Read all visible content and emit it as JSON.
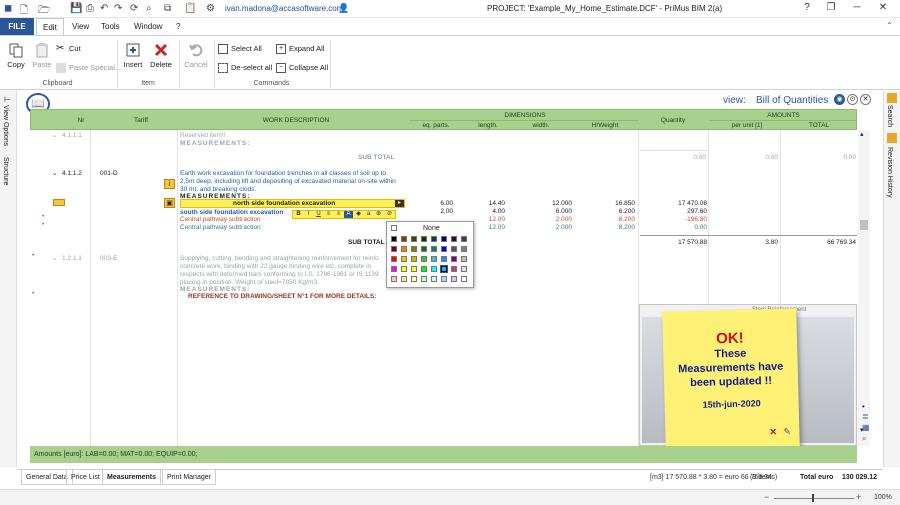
{
  "title_bar": {
    "user": "ivan.madona@accasoftware.com",
    "project": "PROJECT: 'Example_My_Home_Estimate.DCF' - PriMus   BIM 2(a)"
  },
  "menu": {
    "tabs": [
      "FILE",
      "Edit",
      "View",
      "Tools",
      "Window",
      "?"
    ]
  },
  "ribbon": {
    "copy": "Copy",
    "paste": "Paste",
    "cut": "Cut",
    "paste_special": "Paste Special...",
    "clipboard_group": "Clipboard",
    "insert": "Insert",
    "delete": "Delete",
    "item_group": "Item",
    "cancel": "Cancel",
    "select_all": "Select All",
    "deselect_all": "De-select all",
    "expand_all": "Expand All",
    "collapse_all": "Collapse All",
    "commands_group": "Commands"
  },
  "side_panels": {
    "left": [
      "View Options",
      "Structure"
    ],
    "right": [
      "Search",
      "Revision History"
    ]
  },
  "view": {
    "label": "view:",
    "name": "Bill of Quantities"
  },
  "table": {
    "headers": {
      "nr": "Nr",
      "tariff": "Tariff",
      "description": "WORK DESCRIPTION",
      "dimensions": "DIMENSIONS",
      "eq_parts": "eq. parts.",
      "length": "length.",
      "width": "width.",
      "height": "H/Weight",
      "quantity": "Quantity",
      "amounts": "AMOUNTS",
      "per_unit": "per unit [1]",
      "total": "TOTAL"
    },
    "row1": {
      "nr": "4.1.1.1",
      "desc": "Reserved item!!",
      "measurements": "MEASUREMENTS:",
      "subtotal_label": "SUB TOTAL",
      "quantity": "0.00",
      "per_unit": "0.00",
      "total": "0.00"
    },
    "row2": {
      "nr": "4.1.1.2",
      "tariff": "001-D",
      "desc": [
        "Earth work excavation for foundation trenches in all classes of soil up to",
        "2,5m deep, including lift and depositing of excavated material on-site within",
        "30 mt. and breaking clods."
      ],
      "measurements": "MEASUREMENTS:",
      "lines": [
        {
          "desc": "north side foundation excavation",
          "eq": "6.00",
          "len": "14.40",
          "wid": "12.000",
          "h": "16.850",
          "qty": "17 470.08",
          "style": "edit"
        },
        {
          "desc": "south side foundation excavation",
          "eq": "2.00",
          "len": "4.00",
          "wid": "6.000",
          "h": "6.200",
          "qty": "297.60",
          "style": "blue"
        },
        {
          "desc": "Central pathway subtraction",
          "eq": "",
          "len": "12.00",
          "wid": "2.000",
          "h": "8.200",
          "qty": "-196.80",
          "style": "red"
        },
        {
          "desc": "Central pathway subtraction",
          "eq": "",
          "len": "12.00",
          "wid": "2.000",
          "h": "8.200",
          "qty": "0.00",
          "style": "teal"
        }
      ],
      "subtotal_label": "SUB TOTAL",
      "quantity": "17 570.88",
      "per_unit": "3.80",
      "total": "66 769.34"
    },
    "row3": {
      "nr": "1.2.1.1",
      "tariff": "003-E",
      "desc": [
        "Supplying, cutting, bending and straightening reinforcement for reinfo",
        "concrete work, binding with 22 gauge binding wire etc. complete in",
        "respects with deformed bars conforming to I.S. 1786-1961 or IS 1139",
        "placing in position. Weight of steel=7850 Kg/m3."
      ],
      "measurements": "MEASUREMENTS:",
      "reference": "REFERENCE TO DRAWING/SHEET N°1 FOR MORE DETAILS:"
    }
  },
  "color_picker": {
    "none_label": "None",
    "colors": [
      "#000000",
      "#7f3f00",
      "#3f3f00",
      "#003f00",
      "#003f3f",
      "#00007f",
      "#3f003f",
      "#3f3f3f",
      "#7f0000",
      "#ff7f00",
      "#7f7f00",
      "#007f00",
      "#007f7f",
      "#0000ff",
      "#7f3f7f",
      "#7f7f7f",
      "#ff0000",
      "#ffbf00",
      "#bfbf00",
      "#3fbf3f",
      "#3fbfbf",
      "#3f7fff",
      "#7f007f",
      "#bfbfbf",
      "#ff00ff",
      "#ffff00",
      "#ffff00",
      "#00ff00",
      "#00ffff",
      "#00bfff",
      "#bf3f7f",
      "#dfdfdf",
      "#ffbfbf",
      "#ffdf9f",
      "#ffff9f",
      "#bfffbf",
      "#bfffff",
      "#9fdfff",
      "#dfbfff",
      "#ffffff"
    ]
  },
  "note": {
    "ok": "OK!",
    "line1": "These",
    "line2": "Measurements have",
    "line3": "been updated !!",
    "date": "15th-jun-2020"
  },
  "popup_title": "Steel Reinforcement",
  "amounts_bar": "Amounts [euro]:  LAB=0.00;  MAT=0.00;  EQUIP=0.00;",
  "bottom_tabs": [
    "General Data",
    "Price List",
    "Measurements",
    "Print Manager"
  ],
  "status": {
    "formula": "[m3] 17 570.88 * 3.80 = euro 66 769.34",
    "items": "(9 items)",
    "total_label": "Total  euro",
    "total_value": "130 029.12",
    "zoom": "100%"
  }
}
